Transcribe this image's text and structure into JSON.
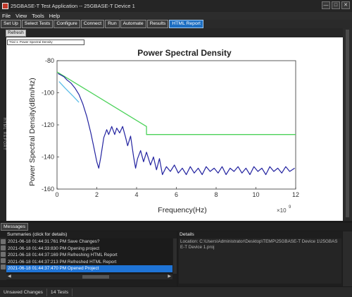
{
  "window": {
    "title": "25GBASE-T Test Application -- 25GBASE-T Device 1",
    "controls": {
      "minimize": "—",
      "maximize": "□",
      "close": "✕"
    }
  },
  "menu": [
    "File",
    "View",
    "Tools",
    "Help"
  ],
  "tabs": [
    {
      "label": "Set Up",
      "active": false
    },
    {
      "label": "Select Tests",
      "active": false
    },
    {
      "label": "Configure",
      "active": false
    },
    {
      "label": "Connect",
      "active": false
    },
    {
      "label": "Run",
      "active": false
    },
    {
      "label": "Automate",
      "active": false
    },
    {
      "label": "Results",
      "active": false
    },
    {
      "label": "HTML Report",
      "active": true
    }
  ],
  "report": {
    "refresh_label": "Refresh",
    "trial_label": "Trial 1: Power Spectral Density",
    "side_label": "HTML REPORT"
  },
  "chart_data": {
    "type": "line",
    "title": "Power Spectral Density",
    "xlabel": "Frequency(Hz)",
    "ylabel": "Power Spectral Density(dBm/Hz)",
    "x_exponent_label": "×10",
    "x_exponent": "9",
    "xlim": [
      0,
      12
    ],
    "ylim": [
      -160,
      -80
    ],
    "xticks": [
      "0",
      "2",
      "4",
      "6",
      "8",
      "10",
      "12"
    ],
    "yticks": [
      "-80",
      "-100",
      "-120",
      "-140",
      "-160"
    ],
    "x_tick_values": [
      0,
      2,
      4,
      6,
      8,
      10,
      12
    ],
    "y_tick_values": [
      -80,
      -100,
      -120,
      -140,
      -160
    ],
    "grid": false,
    "series": [
      {
        "color": "#4cd25a",
        "x": [
          0,
          4.5,
          4.5,
          12
        ],
        "y": [
          -87,
          -121,
          -126,
          -126
        ]
      },
      {
        "color": "#5bbde8",
        "x": [
          0.1,
          0.4,
          0.8,
          1.1
        ],
        "y": [
          -93,
          -97,
          -102,
          -106
        ]
      },
      {
        "color": "#2323a0",
        "x": [
          0.05,
          0.2,
          0.35,
          0.5,
          0.7,
          0.9,
          1.1,
          1.3,
          1.5,
          1.7,
          1.85,
          2.0,
          2.1,
          2.2,
          2.35,
          2.5,
          2.6,
          2.75,
          2.9,
          3.0,
          3.15,
          3.3,
          3.45,
          3.55,
          3.7,
          3.85,
          3.95,
          4.05,
          4.2,
          4.35,
          4.5,
          4.7,
          4.85,
          5.0,
          5.15,
          5.3,
          5.5,
          5.7,
          5.9,
          6.1,
          6.3,
          6.5,
          6.7,
          6.9,
          7.1,
          7.3,
          7.5,
          7.7,
          7.9,
          8.1,
          8.3,
          8.5,
          8.7,
          8.9,
          9.1,
          9.3,
          9.5,
          9.7,
          9.9,
          10.1,
          10.3,
          10.5,
          10.7,
          10.9,
          11.1,
          11.3,
          11.5,
          11.7,
          11.95
        ],
        "y": [
          -88,
          -89,
          -90,
          -92,
          -94,
          -97,
          -101,
          -107,
          -115,
          -125,
          -134,
          -143,
          -147,
          -140,
          -128,
          -123,
          -126,
          -121,
          -126,
          -122,
          -125,
          -121,
          -128,
          -133,
          -127,
          -140,
          -147,
          -141,
          -136,
          -143,
          -137,
          -145,
          -140,
          -148,
          -141,
          -151,
          -146,
          -149,
          -145,
          -150,
          -147,
          -151,
          -146,
          -150,
          -147,
          -151,
          -146,
          -149,
          -147,
          -150,
          -146,
          -151,
          -147,
          -149,
          -146,
          -150,
          -147,
          -151,
          -146,
          -149,
          -147,
          -151,
          -146,
          -149,
          -147,
          -150,
          -146,
          -149,
          -147
        ]
      }
    ]
  },
  "messages": {
    "tab_label": "Messages",
    "summaries_header": "Summaries (click for details)",
    "details_header": "Details",
    "rows": [
      {
        "text": "2021-06-18 01:44:31:761 PM Save Changes?",
        "selected": false
      },
      {
        "text": "2021-06-18 01:44:33:830 PM Opening project",
        "selected": false
      },
      {
        "text": "2021-06-18 01:44:37:169 PM Refreshing HTML Report",
        "selected": false
      },
      {
        "text": "2021-06-18 01:44:37:213 PM Refreshed HTML Report",
        "selected": false
      },
      {
        "text": "2021-06-18 01:44:37:470 PM Opened Project",
        "selected": true
      }
    ],
    "details_text": "Location: C:\\Users\\Administrator\\Desktop\\TEMP\\25GBASE-T Device 1\\25GBASE-T Device 1.proj"
  },
  "status": {
    "unsaved": "Unsaved Changes",
    "tests": "14 Tests"
  }
}
